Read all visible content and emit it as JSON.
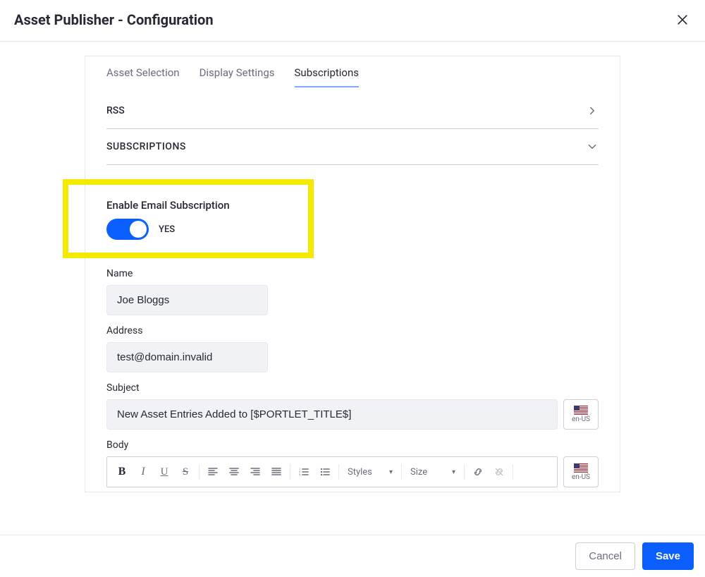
{
  "header": {
    "title": "Asset Publisher - Configuration"
  },
  "tabs": {
    "asset_selection": "Asset Selection",
    "display_settings": "Display Settings",
    "subscriptions": "Subscriptions"
  },
  "sections": {
    "rss": "RSS",
    "subscriptions": "SUBSCRIPTIONS"
  },
  "toggle": {
    "label": "Enable Email Subscription",
    "status": "YES"
  },
  "fields": {
    "name": {
      "label": "Name",
      "value": "Joe Bloggs"
    },
    "address": {
      "label": "Address",
      "value": "test@domain.invalid"
    },
    "subject": {
      "label": "Subject",
      "value": "New Asset Entries Added to [$PORTLET_TITLE$]"
    },
    "body": {
      "label": "Body"
    }
  },
  "locale": {
    "code": "en-US"
  },
  "editor": {
    "styles": "Styles",
    "size": "Size"
  },
  "footer": {
    "cancel": "Cancel",
    "save": "Save"
  }
}
